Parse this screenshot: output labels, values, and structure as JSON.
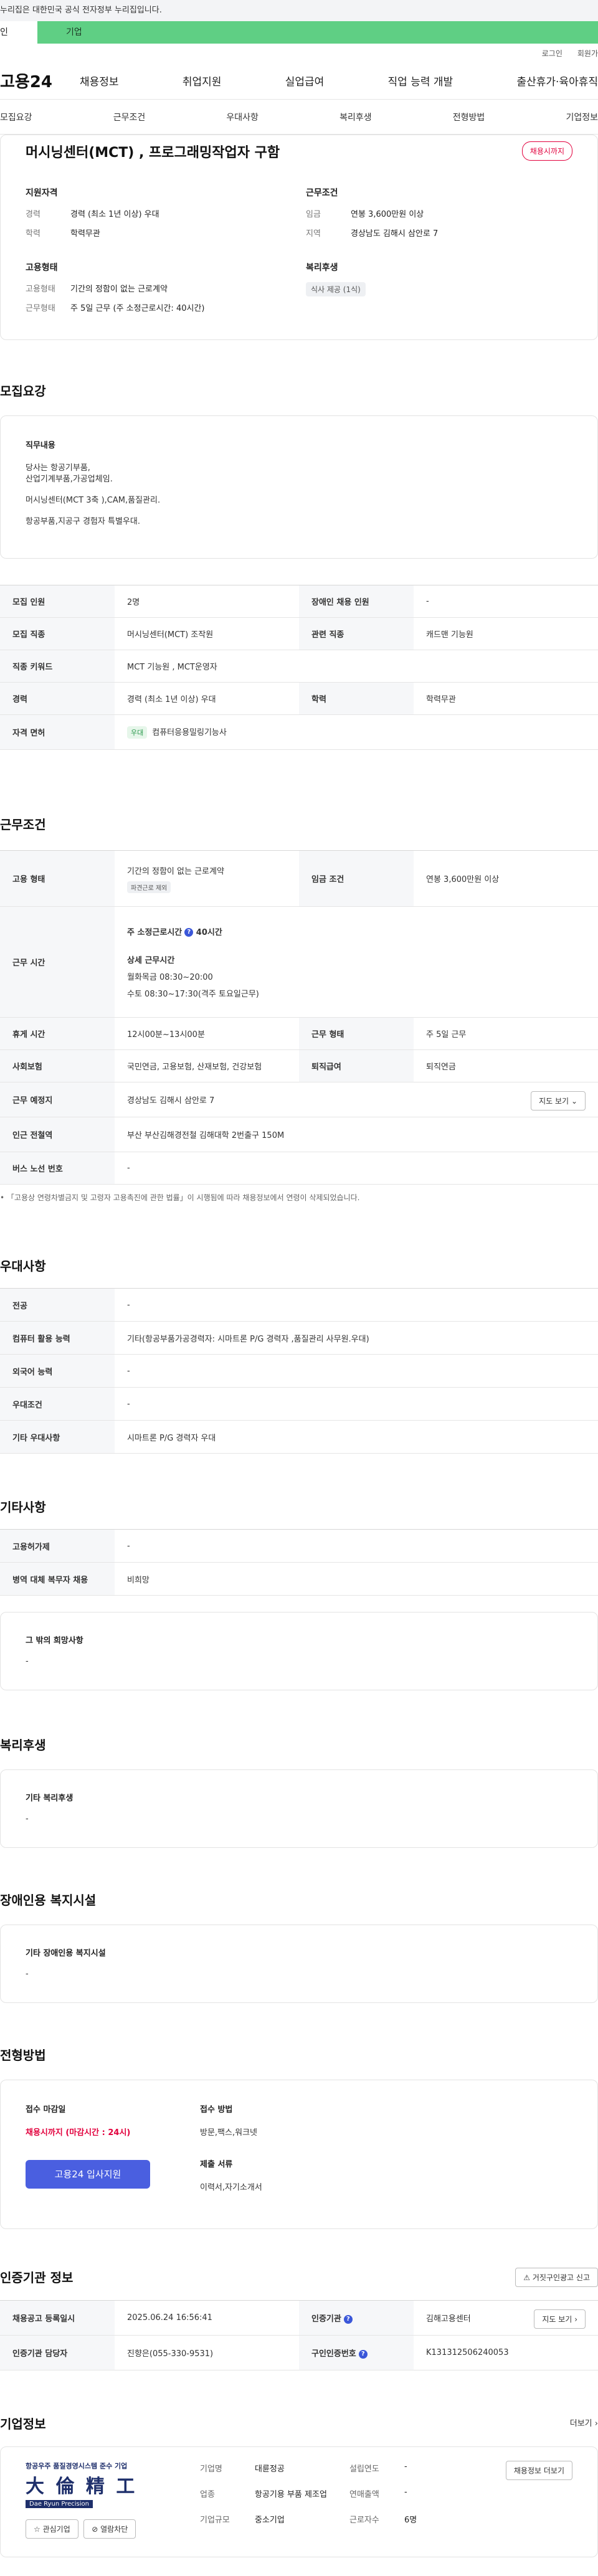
{
  "topbar": {
    "text": "누리집은 대한민국 공식 전자정부 누리집입니다."
  },
  "tabs": [
    "인",
    "기업"
  ],
  "util": [
    "로그인",
    "회원가"
  ],
  "gnb": {
    "logo": "고용24",
    "items": [
      "채용정보",
      "취업지원",
      "실업급여",
      "직업 능력 개발",
      "출산휴가·육아휴직"
    ]
  },
  "subnav": [
    "모집요강",
    "근무조건",
    "우대사항",
    "복리후생",
    "전형방법",
    "기업정보"
  ],
  "hero": {
    "title": "머시닝센터(MCT) , 프로그래밍작업자 구함",
    "badge": "채용시까지",
    "qual_title": "지원자격",
    "qual": [
      {
        "k": "경력",
        "v": "경력 (최소 1년 이상) 우대"
      },
      {
        "k": "학력",
        "v": "학력무관"
      }
    ],
    "cond_title": "근무조건",
    "cond": [
      {
        "k": "임금",
        "v": "연봉 3,600만원 이상"
      },
      {
        "k": "지역",
        "v": "경상남도 김해시 삼안로 7"
      }
    ],
    "emp_title": "고용형태",
    "emp": [
      {
        "k": "고용형태",
        "v": "기간의 정함이 없는 근로계약"
      },
      {
        "k": "근무형태",
        "v": "주 5일 근무 (주 소정근로시간: 40시간)"
      }
    ],
    "welfare_title": "복리후생",
    "welfare_chip": "식사 제공 (1식)"
  },
  "recruit": {
    "title": "모집요강",
    "duty_label": "직무내용",
    "duty_lines": [
      "당사는 항공기부품,",
      "산업기계부품,가공업체임.",
      "",
      "머시닝센터(MCT 3축 ),CAM,품질관리.",
      "",
      "항공부품,지공구 경험자 특별우대."
    ],
    "rows": [
      [
        "모집 인원",
        "2명",
        "장애인 채용 인원",
        "-"
      ],
      [
        "모집 직종",
        "머시닝센터(MCT) 조작원",
        "관련 직종",
        "캐드맨 기능원"
      ],
      [
        "직종 키워드",
        "MCT 기능원 , MCT운영자",
        "",
        ""
      ],
      [
        "경력",
        "경력 (최소 1년 이상) 우대",
        "학력",
        "학력무관"
      ],
      [
        "자격 면허",
        "컴퓨터응용밀링기능사",
        "",
        ""
      ]
    ],
    "license_chip": "우대"
  },
  "work": {
    "title": "근무조건",
    "emp_type_label": "고용 형태",
    "emp_type_val": "기간의 정함이 없는 근로계약",
    "emp_type_chip": "파견근로 제외",
    "wage_label": "임금 조건",
    "wage_val": "연봉 3,600만원 이상",
    "hours_label": "근무 시간",
    "hours_title": "주 소정근로시간",
    "hours_val": "40시간",
    "hours_detail_title": "상세 근무시간",
    "hours_detail": [
      "월화목금 08:30~20:00",
      "수토 08:30~17:30(격주 토요일근무)"
    ],
    "rows": [
      [
        "휴게 시간",
        "12시00분~13시00분",
        "근무 형태",
        "주 5일 근무"
      ],
      [
        "사회보험",
        "국민연금, 고용보험, 산재보험, 건강보험",
        "퇴직급여",
        "퇴직연금"
      ]
    ],
    "place_label": "근무 예정지",
    "place_val": "경상남도 김해시 삼안로 7",
    "map_btn": "지도 보기",
    "subway_label": "인근 전철역",
    "subway_val": "부산 부산김해경전철 김해대학 2번출구 150M",
    "bus_label": "버스 노선 번호",
    "bus_val": "-",
    "note": "「고용상 연령차별금지 및 고령자 고용촉진에 관한 법률」이 시행됨에 따라 채용정보에서 연령이 삭제되었습니다."
  },
  "pref": {
    "title": "우대사항",
    "rows": [
      [
        "전공",
        "-"
      ],
      [
        "컴퓨터 활용 능력",
        "기타(항공부품가공경력자: 시마트론 P/G 경력자 ,품질관리 사무원.우대)"
      ],
      [
        "외국어 능력",
        "-"
      ],
      [
        "우대조건",
        "-"
      ],
      [
        "기타 우대사항",
        "시마트론 P/G 경력자 우대"
      ]
    ]
  },
  "etc": {
    "title": "기타사항",
    "rows": [
      [
        "고용허가제",
        "-"
      ],
      [
        "병역 대체 복무자 채용",
        "비희망"
      ]
    ],
    "box_label": "그 밖의 희망사항",
    "box_val": "-"
  },
  "welfare": {
    "title": "복리후생",
    "box_label": "기타 복리후생",
    "box_val": "-"
  },
  "disabled": {
    "title": "장애인용 복지시설",
    "box_label": "기타 장애인용 복지시설",
    "box_val": "-"
  },
  "screening": {
    "title": "전형방법",
    "deadline_label": "접수 마감일",
    "deadline_val": "채용시까지 (마감시간 : 24시)",
    "apply_btn": "고용24 입사지원",
    "method_label": "접수 방법",
    "method_val": "방문,팩스,워크넷",
    "docs_label": "제출 서류",
    "docs_val": "이력서,자기소개서"
  },
  "agency": {
    "title": "인증기관 정보",
    "report_btn": "거짓구인광고 신고",
    "reg_label": "채용공고 등록일시",
    "reg_val": "2025.06.24 16:56:41",
    "org_label": "인증기관",
    "org_val": "김해고용센터",
    "map_btn": "지도 보기",
    "staff_label": "인증기관 담당자",
    "staff_val": "진향은(055-330-9531)",
    "num_label": "구인인증번호",
    "num_val": "K131312506240053"
  },
  "company": {
    "title": "기업정보",
    "more": "더보기",
    "logo_top": "항공우주 품질경영시스템 준수 기업",
    "logo_main": "大 倫 精 工",
    "logo_sub": "Dae Ryun Precision",
    "fav_btn": "관심기업",
    "block_btn": "열람차단",
    "fields": [
      {
        "k": "기업명",
        "v": "대륜정공"
      },
      {
        "k": "업종",
        "v": "항공기용 부품 제조업"
      },
      {
        "k": "기업규모",
        "v": "중소기업"
      },
      {
        "k": "설립연도",
        "v": "-"
      },
      {
        "k": "연매출액",
        "v": "-"
      },
      {
        "k": "근로자수",
        "v": "6명"
      }
    ],
    "info_btn": "채용정보 더보기"
  }
}
